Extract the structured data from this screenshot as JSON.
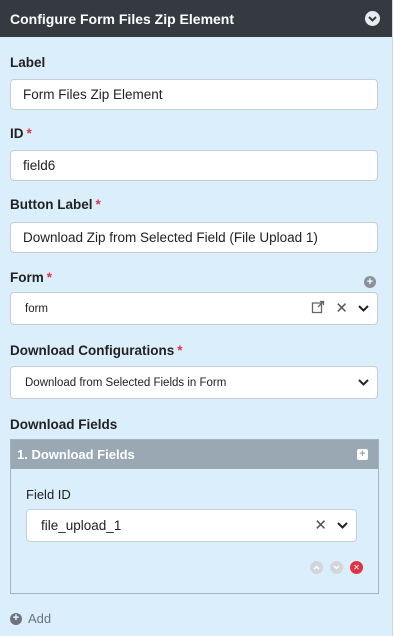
{
  "header": {
    "title": "Configure Form Files Zip Element",
    "collapse_icon": "chevron-down-circle-icon"
  },
  "fields": {
    "label": {
      "label": "Label",
      "value": "Form Files Zip Element"
    },
    "id": {
      "label": "ID",
      "required": "*",
      "value": "field6"
    },
    "button_label": {
      "label": "Button Label",
      "required": "*",
      "value": "Download Zip from Selected Field (File Upload 1)"
    },
    "form": {
      "label": "Form",
      "required": "*",
      "value": "form"
    },
    "download_config": {
      "label": "Download Configurations",
      "required": "*",
      "value": "Download from Selected Fields in Form"
    }
  },
  "download_fields": {
    "label": "Download Fields",
    "group_title": "1. Download Fields",
    "field_id_label": "Field ID",
    "field_id_value": "file_upload_1"
  },
  "add_label": "Add",
  "colors": {
    "header_bg": "#343a40",
    "panel_bg": "#dbeefb",
    "group_head": "#9aa8b4",
    "required": "#dc3545"
  }
}
